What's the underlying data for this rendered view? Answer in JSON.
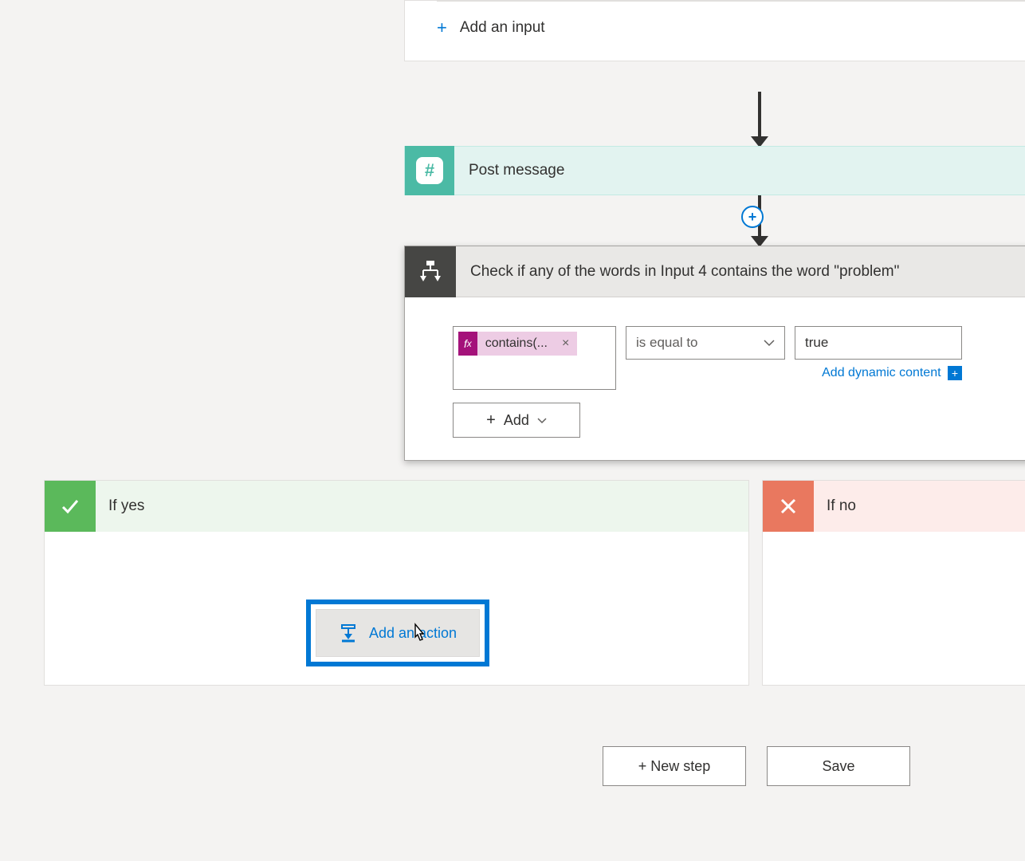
{
  "trigger": {
    "add_input_label": "Add an input"
  },
  "post_message": {
    "title": "Post message"
  },
  "condition": {
    "title": "Check if any of the words in Input 4 contains the word \"problem\"",
    "expression_token": "contains(...",
    "operator": "is equal to",
    "value2": "true",
    "dynamic_link": "Add dynamic content",
    "add_button": "Add"
  },
  "branch_yes": {
    "title": "If yes",
    "add_action": "Add an action"
  },
  "branch_no": {
    "title": "If no"
  },
  "footer": {
    "new_step": "+ New step",
    "save": "Save"
  }
}
